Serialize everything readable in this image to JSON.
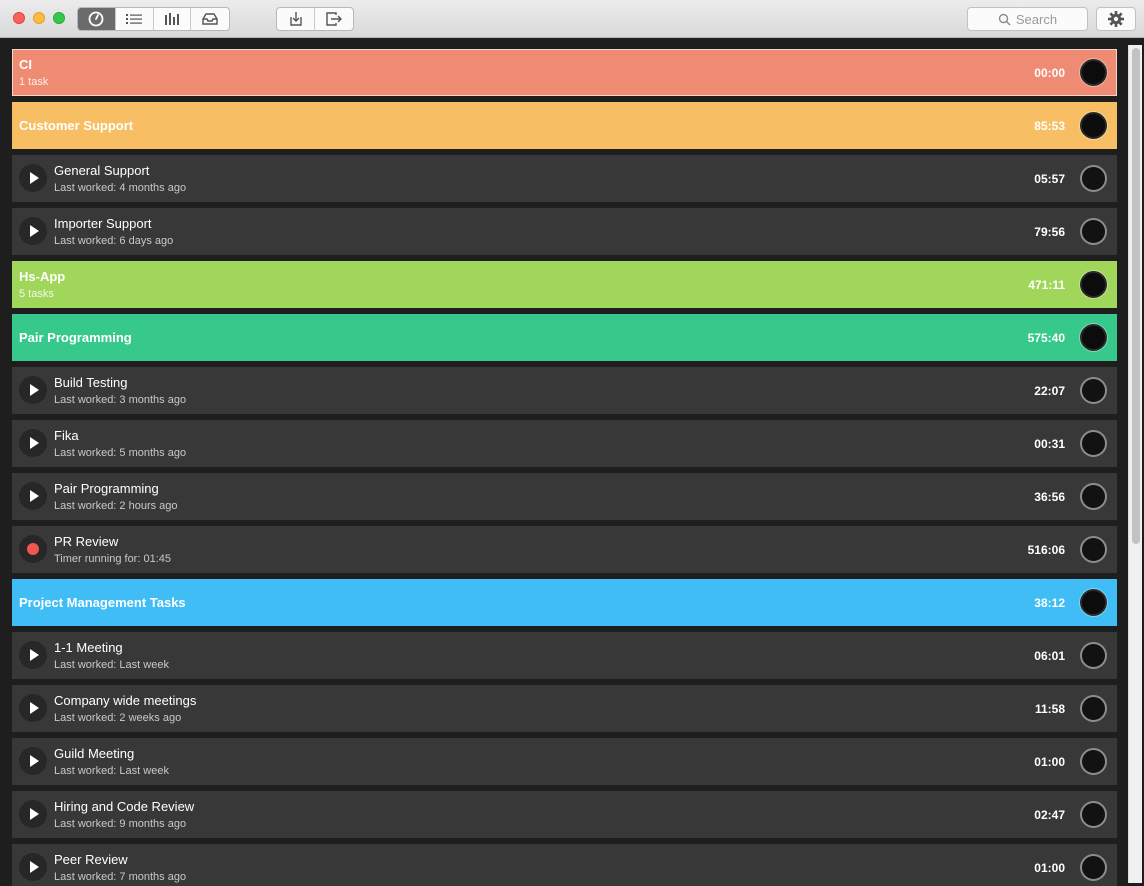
{
  "toolbar": {
    "views": [
      {
        "icon": "timer-icon",
        "active": true
      },
      {
        "icon": "list-icon",
        "active": false
      },
      {
        "icon": "bar-chart-icon",
        "active": false
      },
      {
        "icon": "inbox-icon",
        "active": false
      }
    ],
    "actions": [
      {
        "icon": "import-icon"
      },
      {
        "icon": "export-icon"
      }
    ],
    "search_placeholder": "Search"
  },
  "colors": {
    "ci": "#ef8b72",
    "customer_support": "#f7be63",
    "hs_app": "#a0d65a",
    "pair_programming": "#36c98b",
    "project_management": "#41bdf6",
    "recording": "#f0574f"
  },
  "rows": [
    {
      "kind": "group",
      "title": "CI",
      "subtitle": "1 task",
      "time": "00:00",
      "color": "#ef8b72",
      "selected": true
    },
    {
      "kind": "group",
      "title": "Customer Support",
      "subtitle": "",
      "time": "85:53",
      "color": "#f7be63"
    },
    {
      "kind": "task",
      "title": "General Support",
      "subtitle": "Last worked: 4 months ago",
      "time": "05:57",
      "state": "play"
    },
    {
      "kind": "task",
      "title": "Importer Support",
      "subtitle": "Last worked: 6 days ago",
      "time": "79:56",
      "state": "play"
    },
    {
      "kind": "group",
      "title": "Hs-App",
      "subtitle": "5 tasks",
      "time": "471:11",
      "color": "#a0d65a"
    },
    {
      "kind": "group",
      "title": "Pair Programming",
      "subtitle": "",
      "time": "575:40",
      "color": "#36c98b"
    },
    {
      "kind": "task",
      "title": "Build Testing",
      "subtitle": "Last worked: 3 months ago",
      "time": "22:07",
      "state": "play"
    },
    {
      "kind": "task",
      "title": "Fika",
      "subtitle": "Last worked: 5 months ago",
      "time": "00:31",
      "state": "play"
    },
    {
      "kind": "task",
      "title": "Pair Programming",
      "subtitle": "Last worked: 2 hours ago",
      "time": "36:56",
      "state": "play"
    },
    {
      "kind": "task",
      "title": "PR Review",
      "subtitle": "Timer running for: 01:45",
      "time": "516:06",
      "state": "recording"
    },
    {
      "kind": "group",
      "title": "Project Management Tasks",
      "subtitle": "",
      "time": "38:12",
      "color": "#41bdf6"
    },
    {
      "kind": "task",
      "title": "1-1 Meeting",
      "subtitle": "Last worked: Last week",
      "time": "06:01",
      "state": "play"
    },
    {
      "kind": "task",
      "title": "Company wide meetings",
      "subtitle": "Last worked: 2 weeks ago",
      "time": "11:58",
      "state": "play"
    },
    {
      "kind": "task",
      "title": "Guild Meeting",
      "subtitle": "Last worked: Last week",
      "time": "01:00",
      "state": "play"
    },
    {
      "kind": "task",
      "title": "Hiring and Code Review",
      "subtitle": "Last worked: 9 months ago",
      "time": "02:47",
      "state": "play"
    },
    {
      "kind": "task",
      "title": "Peer Review",
      "subtitle": "Last worked: 7 months ago",
      "time": "01:00",
      "state": "play"
    }
  ]
}
